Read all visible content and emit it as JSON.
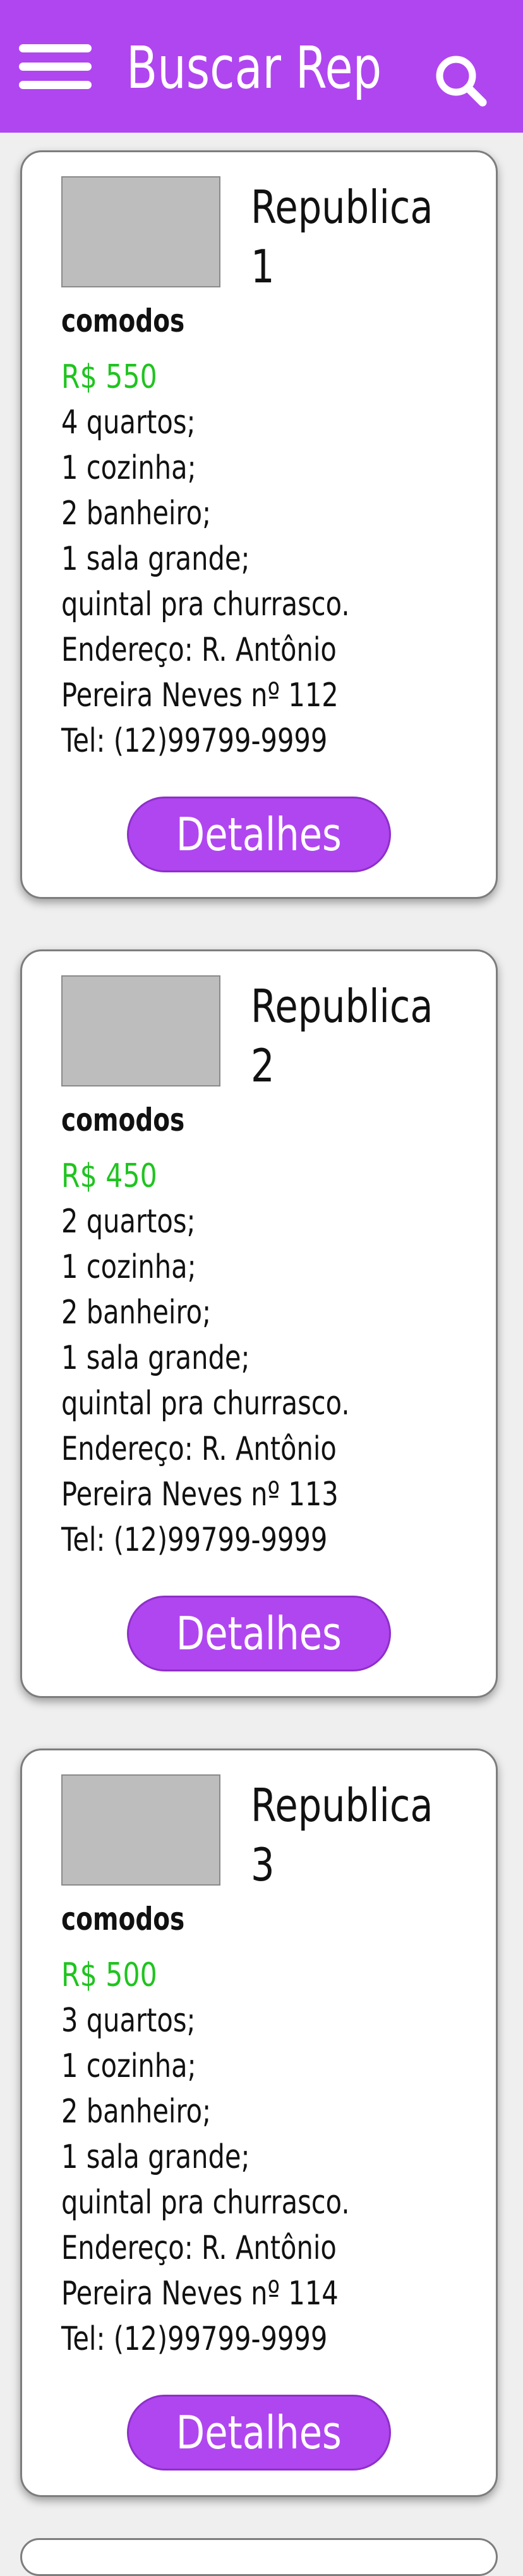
{
  "appbar": {
    "title": "Buscar Rep",
    "menu_icon": "hamburger-menu-icon",
    "search_icon": "search-icon",
    "color": "#b046f0"
  },
  "listings": [
    {
      "name": "Republica\n1",
      "rooms_label": "comodos",
      "price": "R$ 550",
      "details": [
        "4 quartos;",
        "1 cozinha;",
        "2 banheiro;",
        "1 sala grande;",
        "quintal pra churrasco.",
        "Endereço: R. Antônio",
        "Pereira Neves nº 112",
        "Tel: (12)99799-9999"
      ],
      "button": "Detalhes"
    },
    {
      "name": "Republica\n2",
      "rooms_label": "comodos",
      "price": "R$ 450",
      "details": [
        "2 quartos;",
        "1 cozinha;",
        "2 banheiro;",
        "1 sala grande;",
        "quintal pra churrasco.",
        "Endereço: R. Antônio",
        "Pereira Neves nº 113",
        "Tel: (12)99799-9999"
      ],
      "button": "Detalhes"
    },
    {
      "name": "Republica\n3",
      "rooms_label": "comodos",
      "price": "R$ 500",
      "details": [
        "3 quartos;",
        "1 cozinha;",
        "2 banheiro;",
        "1 sala grande;",
        "quintal pra churrasco.",
        "Endereço: R. Antônio",
        "Pereira Neves nº 114",
        "Tel: (12)99799-9999"
      ],
      "button": "Detalhes"
    }
  ],
  "colors": {
    "price": "#1fc41f",
    "button": "#b046f0",
    "background": "#efefef"
  }
}
